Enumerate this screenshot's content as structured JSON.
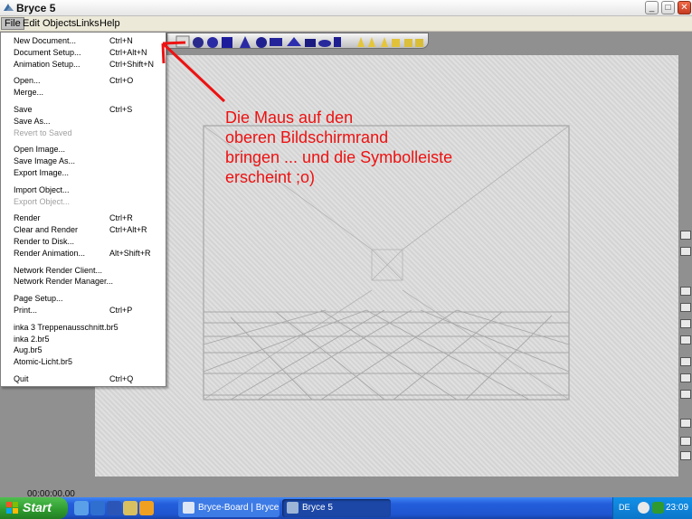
{
  "window": {
    "title": "Bryce 5",
    "minimize_glyph": "_",
    "maximize_glyph": "□",
    "close_glyph": "✕"
  },
  "menubar": [
    "File",
    "Edit",
    "Objects",
    "Links",
    "Help"
  ],
  "file_menu": {
    "items": [
      {
        "label": "New Document...",
        "shortcut": "Ctrl+N",
        "enabled": true
      },
      {
        "label": "Document Setup...",
        "shortcut": "Ctrl+Alt+N",
        "enabled": true
      },
      {
        "label": "Animation Setup...",
        "shortcut": "Ctrl+Shift+N",
        "enabled": true
      },
      {
        "separator": true
      },
      {
        "label": "Open...",
        "shortcut": "Ctrl+O",
        "enabled": true
      },
      {
        "label": "Merge...",
        "shortcut": "",
        "enabled": true
      },
      {
        "separator": true
      },
      {
        "label": "Save",
        "shortcut": "Ctrl+S",
        "enabled": true
      },
      {
        "label": "Save As...",
        "shortcut": "",
        "enabled": true
      },
      {
        "label": "Revert to Saved",
        "shortcut": "",
        "enabled": false
      },
      {
        "separator": true
      },
      {
        "label": "Open Image...",
        "shortcut": "",
        "enabled": true
      },
      {
        "label": "Save Image As...",
        "shortcut": "",
        "enabled": true
      },
      {
        "label": "Export Image...",
        "shortcut": "",
        "enabled": true
      },
      {
        "separator": true
      },
      {
        "label": "Import Object...",
        "shortcut": "",
        "enabled": true
      },
      {
        "label": "Export Object...",
        "shortcut": "",
        "enabled": false
      },
      {
        "separator": true
      },
      {
        "label": "Render",
        "shortcut": "Ctrl+R",
        "enabled": true
      },
      {
        "label": "Clear and Render",
        "shortcut": "Ctrl+Alt+R",
        "enabled": true
      },
      {
        "label": "Render to Disk...",
        "shortcut": "",
        "enabled": true
      },
      {
        "label": "Render Animation...",
        "shortcut": "Alt+Shift+R",
        "enabled": true
      },
      {
        "separator": true
      },
      {
        "label": "Network Render Client...",
        "shortcut": "",
        "enabled": true
      },
      {
        "label": "Network Render Manager...",
        "shortcut": "",
        "enabled": true
      },
      {
        "separator": true
      },
      {
        "label": "Page Setup...",
        "shortcut": "",
        "enabled": true
      },
      {
        "label": "Print...",
        "shortcut": "Ctrl+P",
        "enabled": true
      },
      {
        "separator": true
      },
      {
        "label": "inka 3 Treppenausschnitt.br5",
        "shortcut": "",
        "enabled": true
      },
      {
        "label": "inka 2.br5",
        "shortcut": "",
        "enabled": true
      },
      {
        "label": "Aug.br5",
        "shortcut": "",
        "enabled": true
      },
      {
        "label": "Atomic-Licht.br5",
        "shortcut": "",
        "enabled": true
      },
      {
        "separator": true
      },
      {
        "label": "Quit",
        "shortcut": "Ctrl+Q",
        "enabled": true
      }
    ]
  },
  "annotation": {
    "lines": [
      "Die Maus auf den",
      "oberen Bildschirmrand",
      "bringen ... und die Symbolleiste",
      "erscheint  ;o)"
    ],
    "color": "#ee1111"
  },
  "status": {
    "timecode": "00:00:00.00"
  },
  "taskbar": {
    "start_label": "Start",
    "tasks": [
      {
        "label": "Bryce-Board | Bryce |..."
      },
      {
        "label": "Bryce 5"
      }
    ],
    "tray": {
      "language": "DE",
      "clock": "23:09"
    }
  },
  "colors": {
    "workspace": "#909090",
    "stage": "#dcdcdc",
    "taskbar": "#245edb",
    "start": "#2e9a2e"
  }
}
